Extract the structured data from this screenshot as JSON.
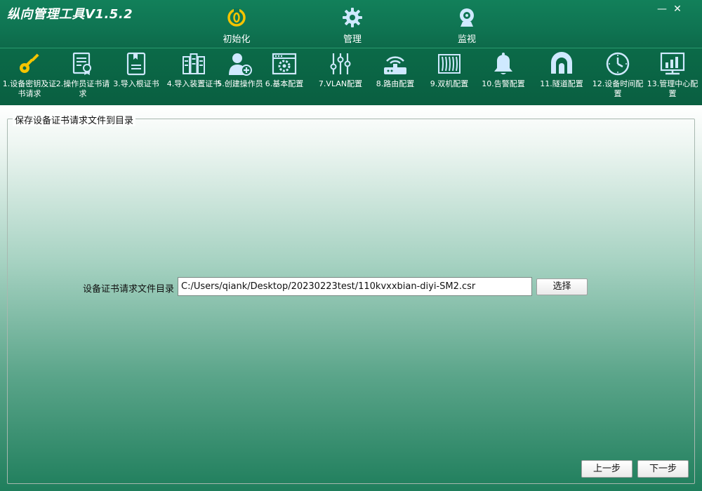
{
  "window": {
    "title": "纵向管理工具V1.5.2",
    "minimize_glyph": "—",
    "close_glyph": "✕"
  },
  "main_nav": [
    {
      "label": "初始化",
      "icon": "power-icon",
      "active": true
    },
    {
      "label": "管理",
      "icon": "gear-icon",
      "active": false
    },
    {
      "label": "监视",
      "icon": "webcam-icon",
      "active": false
    }
  ],
  "toolbar": [
    {
      "label": "1.设备密钥及证书请求",
      "icon": "key-icon"
    },
    {
      "label": "2.操作员证书请求",
      "icon": "certificate-icon"
    },
    {
      "label": "3.导入根证书",
      "icon": "book-icon"
    },
    {
      "label": "4.导入装置证书",
      "icon": "server-rack-icon"
    },
    {
      "label": "5.创建操作员",
      "icon": "add-user-icon"
    },
    {
      "label": "6.基本配置",
      "icon": "settings-window-icon"
    },
    {
      "label": "7.VLAN配置",
      "icon": "sliders-icon"
    },
    {
      "label": "8.路由配置",
      "icon": "router-icon"
    },
    {
      "label": "9.双机配置",
      "icon": "radiator-icon"
    },
    {
      "label": "10.告警配置",
      "icon": "bell-icon"
    },
    {
      "label": "11.隧道配置",
      "icon": "tunnel-icon"
    },
    {
      "label": "12.设备时间配置",
      "icon": "clock-icon"
    },
    {
      "label": "13.管理中心配置",
      "icon": "monitor-chart-icon"
    }
  ],
  "content": {
    "group_title": "保存设备证书请求文件到目录",
    "field_label": "设备证书请求文件目录",
    "field_value": "C:/Users/qiank/Desktop/20230223test/110kvxxbian-diyi-SM2.csr",
    "choose_button": "选择",
    "prev_button": "上一步",
    "next_button": "下一步"
  },
  "colors": {
    "accent_yellow": "#f5c400",
    "header_green": "#0f7452",
    "icon_blue": "#cfe9ff"
  }
}
